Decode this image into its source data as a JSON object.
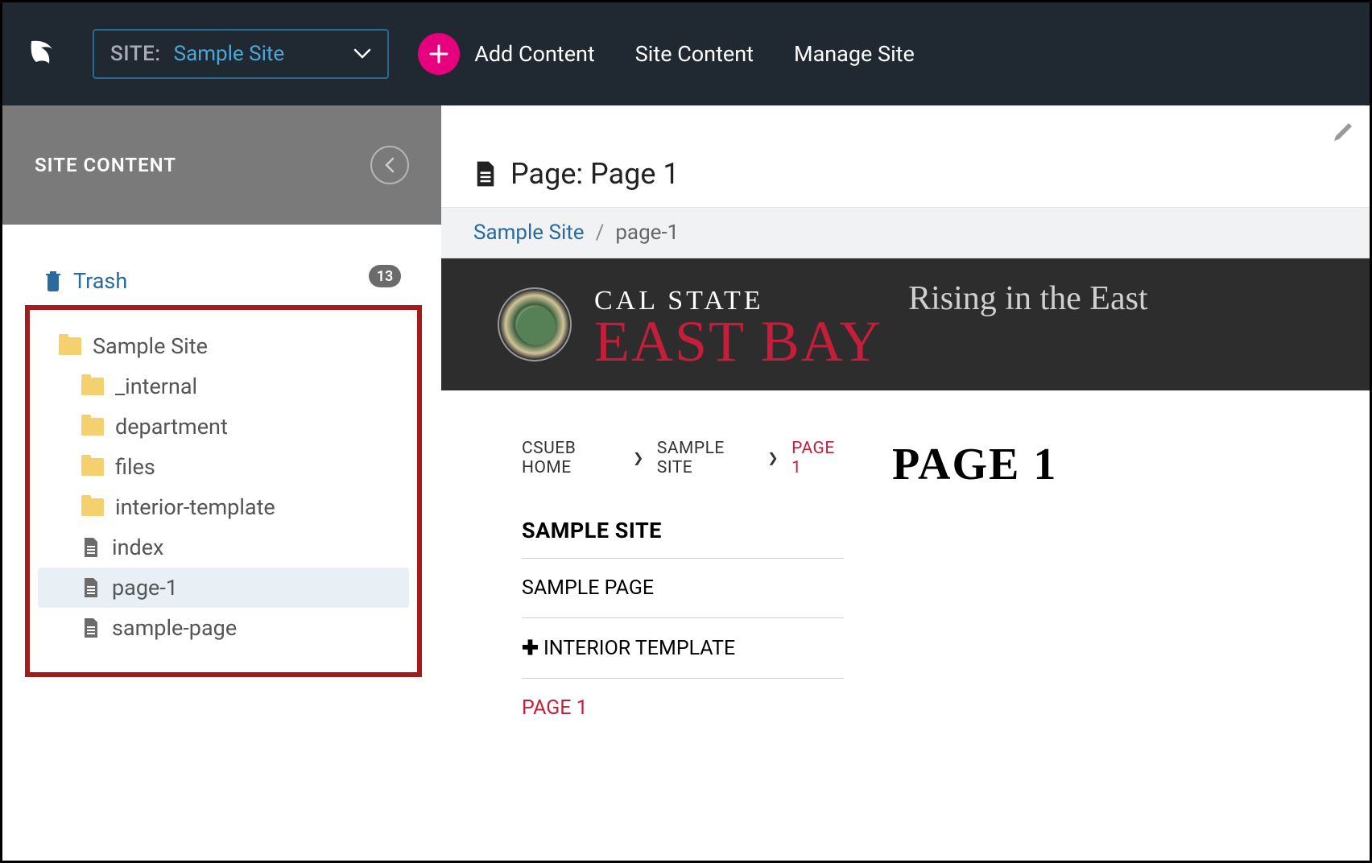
{
  "topbar": {
    "site_label": "SITE:",
    "site_value": "Sample Site",
    "add_content": "Add Content",
    "site_content": "Site Content",
    "manage_site": "Manage Site"
  },
  "sidebar": {
    "title": "SITE CONTENT",
    "trash_label": "Trash",
    "trash_count": "13",
    "tree": {
      "root": "Sample Site",
      "items": [
        {
          "label": "_internal",
          "type": "folder"
        },
        {
          "label": "department",
          "type": "folder"
        },
        {
          "label": "files",
          "type": "folder"
        },
        {
          "label": "interior-template",
          "type": "folder"
        },
        {
          "label": "index",
          "type": "page"
        },
        {
          "label": "page-1",
          "type": "page",
          "selected": true
        },
        {
          "label": "sample-page",
          "type": "page"
        }
      ]
    }
  },
  "content": {
    "heading": "Page: Page 1",
    "breadcrumb": {
      "root": "Sample Site",
      "current": "page-1"
    }
  },
  "preview": {
    "banner": {
      "line1": "CAL STATE",
      "line2": "EAST BAY",
      "tagline": "Rising in the East"
    },
    "breadcrumb": {
      "home": "CSUEB HOME",
      "site": "SAMPLE SITE",
      "page": "PAGE 1"
    },
    "sidenav": {
      "title": "SAMPLE SITE",
      "items": [
        {
          "label": "SAMPLE PAGE"
        },
        {
          "label": "INTERIOR TEMPLATE",
          "expandable": true
        },
        {
          "label": "PAGE 1",
          "active": true
        }
      ]
    },
    "title": "PAGE 1"
  }
}
